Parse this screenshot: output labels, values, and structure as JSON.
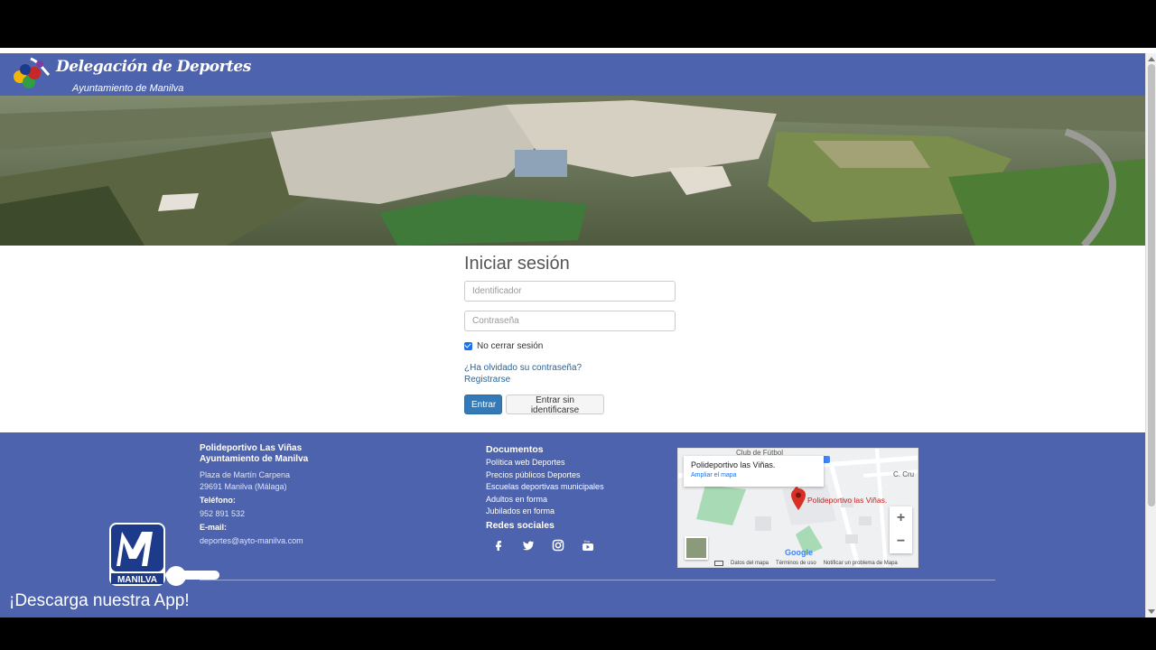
{
  "header": {
    "title": "Delegación de Deportes",
    "subtitle": "Ayuntamiento de Manilva"
  },
  "login": {
    "title": "Iniciar sesión",
    "user_placeholder": "Identificador",
    "password_placeholder": "Contraseña",
    "remember_label": "No cerrar sesión",
    "remember_checked": true,
    "forgot_link": "¿Ha olvidado su contraseña?",
    "register_link": "Registrarse",
    "submit_button": "Entrar",
    "guest_button": "Entrar sin identificarse"
  },
  "footer": {
    "venue_name": "Polideportivo Las Viñas",
    "venue_org": "Ayuntamiento de Manilva",
    "address_line1": "Plaza de Martín Carpena",
    "address_line2": "29691 Manilva (Málaga)",
    "phone_label": "Teléfono:",
    "phone": "952 891 532",
    "email_label": "E-mail:",
    "email": "deportes@ayto-manilva.com",
    "documents_title": "Documentos",
    "documents": [
      "Política web Deportes",
      "Precios públicos Deportes",
      "Escuelas deportivas municipales",
      "Adultos en forma",
      "Jubilados en forma"
    ],
    "social_title": "Redes sociales",
    "social_icons": [
      "facebook-icon",
      "twitter-icon",
      "instagram-icon",
      "youtube-icon"
    ]
  },
  "map": {
    "place_name": "Polideportivo las Viñas.",
    "enlarge_link": "Ampliar el mapa",
    "marker_label": "Polideportivo las Viñas.",
    "top_label": "Club de Fútbol",
    "street_label": "C. Cru",
    "google_label": "Google",
    "footer_items": [
      "Datos del mapa",
      "Términos de uso",
      "Notificar un problema de Mapa"
    ],
    "zoom_in": "+",
    "zoom_out": "−"
  },
  "promo": {
    "logo_text": "MANILVA",
    "download_text": "¡Descarga nuestra App!"
  },
  "colors": {
    "header_blue": "#4d63ad",
    "primary_button": "#337ab7",
    "link": "#2a6496"
  }
}
